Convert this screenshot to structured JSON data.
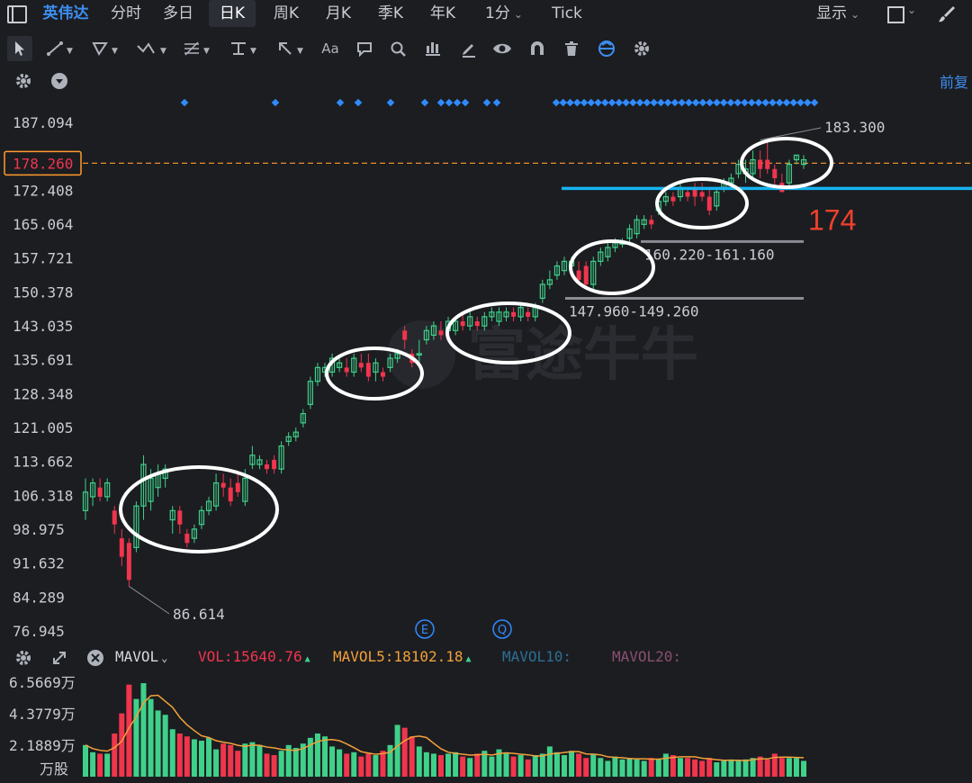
{
  "header": {
    "stock_name": "英伟达",
    "tabs": [
      {
        "label": "分时"
      },
      {
        "label": "多日"
      },
      {
        "label": "日K",
        "active": true
      },
      {
        "label": "周K"
      },
      {
        "label": "月K"
      },
      {
        "label": "季K"
      },
      {
        "label": "年K"
      },
      {
        "label": "1分",
        "dropdown": true
      },
      {
        "label": "Tick"
      }
    ],
    "display_label": "显示"
  },
  "toolbar": {
    "text_tool": "Aa",
    "icons": [
      "cursor-icon",
      "line-tool-icon",
      "polygon-tool-icon",
      "wave-tool-icon",
      "fib-tool-icon",
      "horizontal-line-icon",
      "arrow-tool-icon",
      "text-tool-icon",
      "comment-icon",
      "search-icon",
      "measure-icon",
      "pen-icon",
      "eye-icon",
      "magnet-icon",
      "trash-icon",
      "sync-icon",
      "gear-icon"
    ]
  },
  "subbar": {
    "adjust_label": "前复"
  },
  "price_axis": {
    "ticks": [
      "187.094",
      "178.260",
      "172.408",
      "165.064",
      "157.721",
      "150.378",
      "143.035",
      "135.691",
      "128.348",
      "121.005",
      "113.662",
      "106.318",
      "98.975",
      "91.632",
      "84.289",
      "76.945"
    ],
    "current_price": "178.260"
  },
  "chart_data": {
    "type": "candlestick",
    "y_range": [
      76.945,
      187.094
    ],
    "candles": [
      [
        103,
        107,
        101,
        110
      ],
      [
        106,
        109,
        104,
        110
      ],
      [
        108,
        106,
        105,
        110
      ],
      [
        106,
        109,
        105,
        110
      ],
      [
        103,
        100,
        98,
        104
      ],
      [
        97,
        93,
        91,
        99
      ],
      [
        96,
        88,
        86.614,
        97
      ],
      [
        95,
        104,
        94,
        105
      ],
      [
        104,
        113,
        101,
        115
      ],
      [
        105,
        110,
        103,
        112
      ],
      [
        108,
        111,
        106,
        113
      ],
      [
        110,
        112,
        108,
        113
      ],
      [
        101,
        103,
        98,
        104
      ],
      [
        103,
        100,
        98,
        104
      ],
      [
        98,
        96,
        95,
        99
      ],
      [
        97,
        99,
        96,
        100
      ],
      [
        100,
        103,
        99,
        104
      ],
      [
        103,
        105,
        102,
        106
      ],
      [
        104,
        109,
        103,
        111
      ],
      [
        109,
        108,
        106,
        111
      ],
      [
        108,
        105,
        104,
        110
      ],
      [
        109,
        107,
        106,
        111
      ],
      [
        105,
        110,
        104,
        112
      ],
      [
        113,
        115,
        112,
        117
      ],
      [
        113,
        114,
        112,
        115
      ],
      [
        113,
        112,
        111,
        114
      ],
      [
        114,
        112,
        111,
        115
      ],
      [
        112,
        117,
        111,
        118
      ],
      [
        118,
        119,
        117,
        120
      ],
      [
        119,
        120,
        118,
        121
      ],
      [
        122,
        124,
        121,
        125
      ],
      [
        126,
        131,
        125,
        132
      ],
      [
        131,
        134,
        130,
        135
      ],
      [
        133,
        134,
        132,
        135
      ],
      [
        133,
        136,
        132,
        137
      ],
      [
        134,
        135,
        133,
        136
      ],
      [
        134,
        133,
        132,
        136
      ],
      [
        133,
        136,
        132,
        137
      ],
      [
        135,
        134,
        133,
        137
      ],
      [
        135,
        132,
        131,
        137
      ],
      [
        133,
        135,
        131,
        136
      ],
      [
        133,
        132,
        131,
        134
      ],
      [
        134,
        136,
        133,
        137
      ],
      [
        136,
        137,
        135,
        138
      ],
      [
        142,
        140,
        138,
        143
      ],
      [
        137,
        135,
        134,
        138
      ],
      [
        137,
        137,
        134,
        140
      ],
      [
        140,
        142,
        139,
        143
      ],
      [
        141,
        143,
        140,
        144
      ],
      [
        142,
        141,
        140,
        144
      ],
      [
        142,
        144,
        141,
        145
      ],
      [
        142,
        144,
        141,
        145
      ],
      [
        144,
        143,
        142,
        146
      ],
      [
        143,
        145,
        142,
        146
      ],
      [
        144,
        143,
        142,
        145
      ],
      [
        143,
        145,
        142,
        146
      ],
      [
        145,
        146,
        144,
        147
      ],
      [
        144,
        146,
        143,
        147
      ],
      [
        145,
        146,
        144,
        147
      ],
      [
        146,
        145,
        144,
        147
      ],
      [
        145,
        147,
        144,
        148
      ],
      [
        146,
        145,
        144,
        147
      ],
      [
        145,
        147,
        144,
        148
      ],
      [
        149,
        152,
        148,
        153
      ],
      [
        152,
        153,
        151,
        155
      ],
      [
        154,
        156,
        153,
        157
      ],
      [
        155,
        157,
        154,
        158
      ],
      [
        156,
        157,
        155,
        158
      ],
      [
        155,
        153,
        152,
        157
      ],
      [
        156,
        152,
        151,
        157
      ],
      [
        152,
        157,
        151,
        158
      ],
      [
        157,
        159,
        156,
        160
      ],
      [
        158,
        160,
        157,
        161
      ],
      [
        160,
        161,
        159,
        162
      ],
      [
        161,
        161,
        160,
        162
      ],
      [
        162,
        164,
        161,
        165
      ],
      [
        163,
        166,
        162,
        167
      ],
      [
        165,
        166,
        164,
        167
      ],
      [
        166,
        165,
        164,
        167
      ],
      [
        168,
        170,
        167,
        171
      ],
      [
        170,
        171,
        169,
        172
      ],
      [
        171,
        170,
        169,
        172
      ],
      [
        171,
        173,
        170,
        174
      ],
      [
        172,
        171,
        170,
        173
      ],
      [
        173,
        171,
        169,
        174
      ],
      [
        172,
        171,
        170,
        174
      ],
      [
        171,
        168,
        167,
        173
      ],
      [
        169,
        172,
        168,
        173
      ],
      [
        173,
        174,
        172,
        175
      ],
      [
        174,
        175,
        173,
        176
      ],
      [
        176,
        178,
        175,
        179
      ],
      [
        176,
        177,
        174,
        179
      ],
      [
        176,
        179,
        175,
        181
      ],
      [
        179,
        177,
        175,
        181
      ],
      [
        179,
        177,
        176,
        183.3
      ],
      [
        177,
        175,
        173,
        178
      ],
      [
        174,
        172,
        172,
        176
      ],
      [
        174,
        178,
        173,
        179
      ],
      [
        179,
        180,
        178,
        180
      ],
      [
        178,
        179,
        177,
        180
      ]
    ],
    "markers_count": 50,
    "annotations": {
      "low_label": "86.614",
      "high_label": "183.300",
      "range_label_1": "147.960-149.260",
      "range_label_2": "160.220-161.160",
      "level_label": "174",
      "events": [
        "E",
        "Q"
      ]
    },
    "volume": {
      "ticks": [
        "6.5669万",
        "4.3779万",
        "2.1889万"
      ],
      "unit": "万股",
      "y_range": [
        0,
        6.5669
      ],
      "bars": [
        2.2,
        1.7,
        1.6,
        1.6,
        3.0,
        4.4,
        6.4,
        5.4,
        6.5,
        5.4,
        4.6,
        4.3,
        3.3,
        3.0,
        2.8,
        2.6,
        2.5,
        2.7,
        1.9,
        2.3,
        2.2,
        1.8,
        2.3,
        2.4,
        2.2,
        1.6,
        1.5,
        1.8,
        2.2,
        2.0,
        2.3,
        2.7,
        3.0,
        2.8,
        2.1,
        1.9,
        1.6,
        1.7,
        1.4,
        1.6,
        1.5,
        1.8,
        2.2,
        3.6,
        3.4,
        2.8,
        2.1,
        1.7,
        1.6,
        1.5,
        1.6,
        1.7,
        1.4,
        1.3,
        1.6,
        1.8,
        1.4,
        1.9,
        1.6,
        1.4,
        1.5,
        1.2,
        1.5,
        1.6,
        2.1,
        1.7,
        1.5,
        1.8,
        1.6,
        1.3,
        1.6,
        1.3,
        1.1,
        1.4,
        1.2,
        1.3,
        1.2,
        1.1,
        1.3,
        1.2,
        1.6,
        1.5,
        1.3,
        1.3,
        1.2,
        1.1,
        1.3,
        1.0,
        1.1,
        1.2,
        1.1,
        1.2,
        1.3,
        1.4,
        1.2,
        1.6,
        1.3,
        1.3,
        1.3,
        1.1
      ],
      "mavol_label": "MAVOL",
      "vol_text": "VOL:15640.76",
      "mavol5_text": "MAVOL5:18102.18",
      "mavol10_text": "MAVOL10:",
      "mavol20_text": "MAVOL20:"
    },
    "colors": {
      "up": "#3fd18a",
      "down": "#f0354d",
      "current_price_line": "#ff9b2e",
      "support_line": "#16b4f0",
      "marker": "#2f8bff",
      "ma_line": "#f2a13a",
      "level_text": "#f0412d"
    },
    "watermark": "富途牛牛"
  }
}
